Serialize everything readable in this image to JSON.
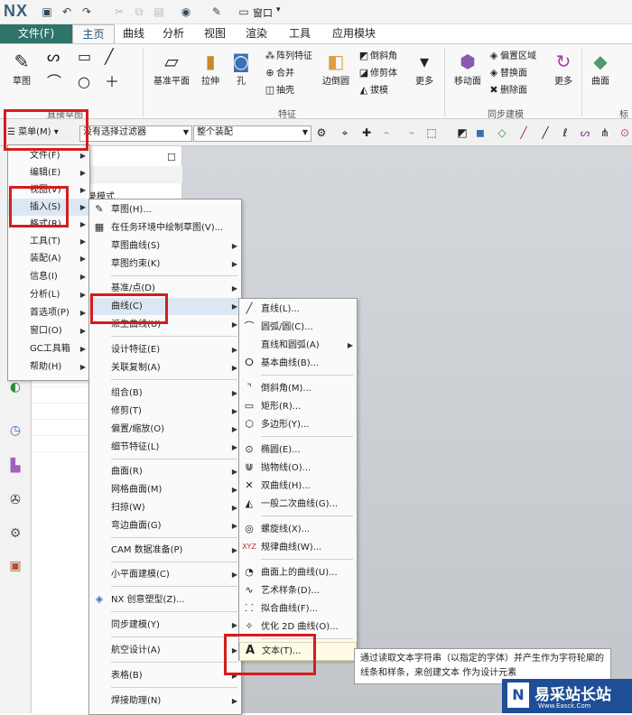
{
  "titlebar": {
    "logo": "NX",
    "quick_icons": [
      "save-icon",
      "undo-icon",
      "redo-icon",
      "cut-icon",
      "copy-icon",
      "paste-icon",
      "touch-mode-icon",
      "window-icon"
    ],
    "window_label": "窗口"
  },
  "tabs": [
    "文件(F)",
    "主页",
    "曲线",
    "分析",
    "视图",
    "渲染",
    "工具",
    "应用模块"
  ],
  "ribbon": {
    "sketch": "草图",
    "sketch_group": "直接草图",
    "datum": "基准平面",
    "extrude": "拉伸",
    "hole": "孔",
    "feature_small": [
      "阵列特征",
      "合并",
      "抽壳"
    ],
    "edge_blend": "边倒圆",
    "feature_small2": [
      "倒斜角",
      "修剪体",
      "拔模"
    ],
    "more1": "更多",
    "feature_group": "特征",
    "move_face": "移动面",
    "sync_small": [
      "偏置区域",
      "替换面",
      "删除面"
    ],
    "more2": "更多",
    "sync_group": "同步建模",
    "surface": "曲面",
    "std_group": "标"
  },
  "filterbar": {
    "menu_button": "菜单(M)",
    "filter": "没有选择过滤器",
    "assembly": "整个装配"
  },
  "nav": {
    "partial_text": "录模式"
  },
  "main_menu": [
    "文件(F)",
    "编辑(E)",
    "视图(V)",
    "插入(S)",
    "格式(R)",
    "工具(T)",
    "装配(A)",
    "信息(I)",
    "分析(L)",
    "首选项(P)",
    "窗口(O)",
    "GC工具箱",
    "帮助(H)"
  ],
  "insert_menu": [
    "草图(H)...",
    "在任务环境中绘制草图(V)...",
    "草图曲线(S)",
    "草图约束(K)",
    "基准/点(D)",
    "曲线(C)",
    "派生曲线(U)",
    "设计特征(E)",
    "关联复制(A)",
    "组合(B)",
    "修剪(T)",
    "偏置/缩放(O)",
    "细节特征(L)",
    "曲面(R)",
    "网格曲面(M)",
    "扫掠(W)",
    "弯边曲面(G)",
    "CAM 数据准备(P)",
    "小平面建模(C)",
    "NX 创意塑型(Z)...",
    "同步建模(Y)",
    "航空设计(A)",
    "表格(B)",
    "焊接助理(N)"
  ],
  "curve_menu": [
    "直线(L)...",
    "圆弧/圆(C)...",
    "直线和圆弧(A)",
    "基本曲线(B)...",
    "倒斜角(M)...",
    "矩形(R)...",
    "多边形(Y)...",
    "椭圆(E)...",
    "抛物线(O)...",
    "双曲线(H)...",
    "一般二次曲线(G)...",
    "螺旋线(X)...",
    "规律曲线(W)...",
    "曲面上的曲线(U)...",
    "艺术样条(D)...",
    "拟合曲线(F)...",
    "优化 2D 曲线(O)...",
    "文本(T)..."
  ],
  "tooltip": "通过读取文本字符串（以指定的字体）并产生作为字符轮廓的线条和样条，来创建文本 作为设计元素",
  "watermark": {
    "title": "易采站长站",
    "subtitle": "Www.Easck.Com"
  },
  "colors": {
    "file_tab": "#2f7469",
    "highlight_box": "#d41d1d",
    "watermark_bg": "#1e4f96"
  }
}
